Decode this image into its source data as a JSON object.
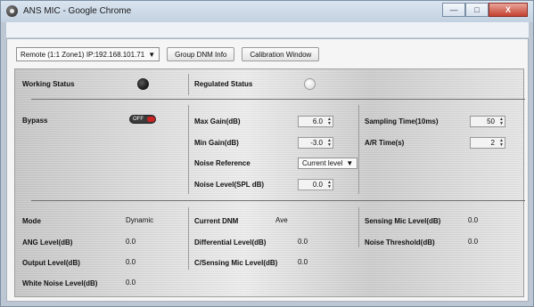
{
  "window": {
    "title": "ANS MIC - Google Chrome",
    "icons": {
      "app": "chrome-icon",
      "minimize": "minimize-icon",
      "maximize": "maximize-icon",
      "close": "close-icon"
    },
    "controls": {
      "minimize": "—",
      "maximize": "□",
      "close": "X"
    }
  },
  "toolbar": {
    "device_select": "Remote (1:1 Zone1) IP:192.168.101.71",
    "device_select_arrow": "▼",
    "group_dnm_info": "Group DNM Info",
    "calibration_window": "Calibration Window"
  },
  "status": {
    "working_label": "Working Status",
    "regulated_label": "Regulated Status"
  },
  "settings": {
    "bypass_label": "Bypass",
    "bypass_toggle_text": "OFF",
    "max_gain_label": "Max Gain(dB)",
    "max_gain_value": "6.0",
    "min_gain_label": "Min Gain(dB)",
    "min_gain_value": "-3.0",
    "noise_reference_label": "Noise Reference",
    "noise_reference_value": "Current level",
    "noise_reference_arrow": "▼",
    "noise_level_label": "Noise Level(SPL dB)",
    "noise_level_value": "0.0",
    "sampling_time_label": "Sampling Time(10ms)",
    "sampling_time_value": "50",
    "ar_time_label": "A/R Time(s)",
    "ar_time_value": "2",
    "spin_up": "▲",
    "spin_down": "▼"
  },
  "readouts": {
    "mode_label": "Mode",
    "mode_value": "Dynamic",
    "ang_level_label": "ANG Level(dB)",
    "ang_level_value": "0.0",
    "output_level_label": "Output Level(dB)",
    "output_level_value": "0.0",
    "white_noise_label": "White Noise Level(dB)",
    "white_noise_value": "0.0",
    "current_dnm_label": "Current DNM",
    "current_dnm_value": "Ave",
    "differential_label": "Differential Level(dB)",
    "differential_value": "0.0",
    "c_sensing_label": "C/Sensing Mic Level(dB)",
    "c_sensing_value": "0.0",
    "sensing_mic_label": "Sensing Mic Level(dB)",
    "sensing_mic_value": "0.0",
    "noise_threshold_label": "Noise Threshold(dB)",
    "noise_threshold_value": "0.0"
  }
}
